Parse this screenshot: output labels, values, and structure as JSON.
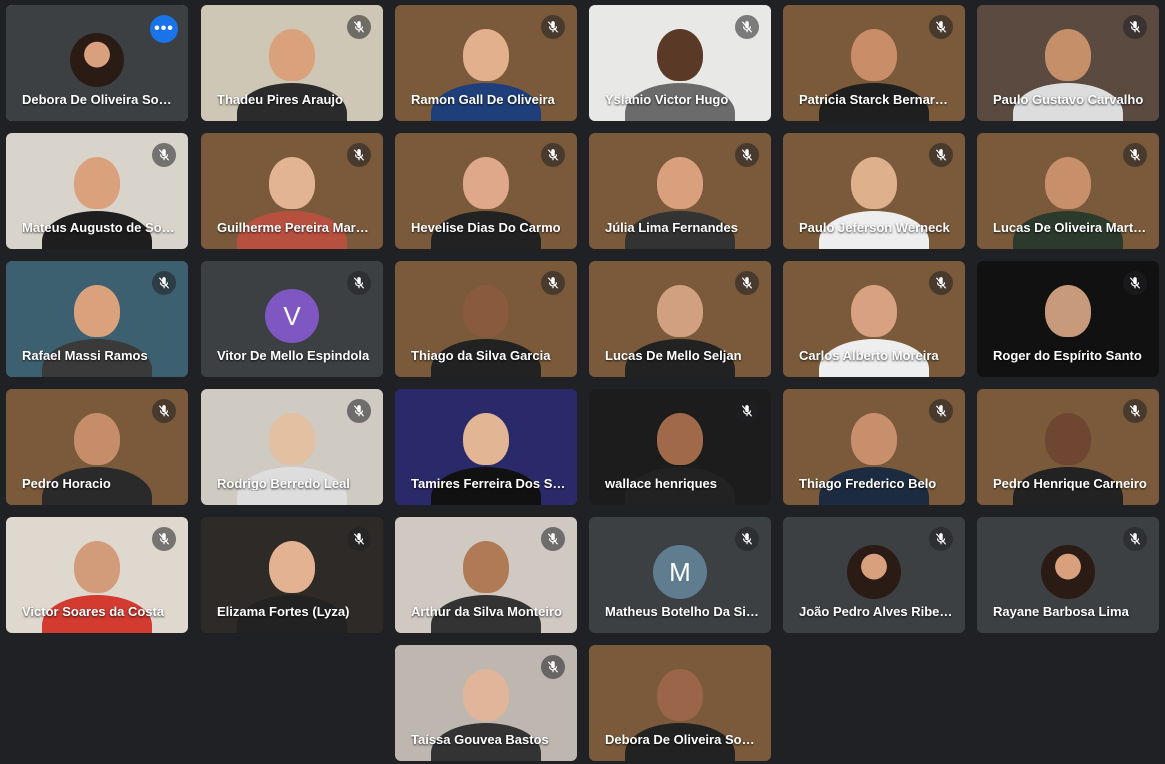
{
  "meeting": {
    "more_options_label": "•••",
    "colors": {
      "background": "#202124",
      "tile": "#3c4043",
      "active_border": "#8ab4f8",
      "more_button": "#1a73e8"
    },
    "participants": [
      {
        "name": "Debora De Oliveira Soares",
        "muted": false,
        "pinned_active": true,
        "avatar": "photo-circle",
        "bg": "#3c4043"
      },
      {
        "name": "Thadeu Pires Araujo",
        "muted": true,
        "bg": "#cfc7b6",
        "skin": "#d9a27c",
        "shirt": "#2b2b2b"
      },
      {
        "name": "Ramon Gall De Oliveira",
        "muted": true,
        "bg": "#7a5a3a",
        "skin": "#e2b08c",
        "shirt": "#1f3f7a"
      },
      {
        "name": "Yslanio Victor Hugo",
        "muted": true,
        "bg": "#e8e8e6",
        "skin": "#5a3a26",
        "shirt": "#6b6b6b"
      },
      {
        "name": "Patricia Starck Bernardes",
        "muted": true,
        "bg": "#7a5a3a",
        "skin": "#c98e68",
        "shirt": "#1f1f1f"
      },
      {
        "name": "Paulo Gustavo Carvalho",
        "muted": true,
        "bg": "#5a4a40",
        "skin": "#c58f6a",
        "shirt": "#ddd"
      },
      {
        "name": "Mateus Augusto de Souza",
        "muted": true,
        "bg": "#d8d4cc",
        "skin": "#d9a27c",
        "shirt": "#1e1e1e"
      },
      {
        "name": "Guilherme Pereira Martins",
        "muted": true,
        "bg": "#7a5a3a",
        "skin": "#e3b493",
        "shirt": "#b85040"
      },
      {
        "name": "Hevelise Dias Do Carmo",
        "muted": true,
        "bg": "#7a5a3a",
        "skin": "#e0a88a",
        "shirt": "#222"
      },
      {
        "name": "Júlia Lima Fernandes",
        "muted": true,
        "bg": "#7a5a3a",
        "skin": "#d9a07e",
        "shirt": "#333"
      },
      {
        "name": "Paulo Jeferson Werneck",
        "muted": true,
        "bg": "#7a5a3a",
        "skin": "#dfb08c",
        "shirt": "#eee"
      },
      {
        "name": "Lucas De Oliveira Martins",
        "muted": true,
        "bg": "#7a5a3a",
        "skin": "#c8906a",
        "shirt": "#2b3a2b"
      },
      {
        "name": "Rafael Massi Ramos",
        "muted": true,
        "bg": "#3d6070",
        "skin": "#d9a27c",
        "shirt": "#3a3a3a"
      },
      {
        "name": "Vitor De Mello Espindola",
        "muted": true,
        "avatar": "letter",
        "letter": "V",
        "avatar_color": "#7e57c2",
        "bg": "#3c4043"
      },
      {
        "name": "Thiago da Silva Garcia",
        "muted": true,
        "bg": "#7a5a3a",
        "skin": "#8a5a3e",
        "shirt": "#222"
      },
      {
        "name": "Lucas De Mello Seljan",
        "muted": true,
        "bg": "#7a5a3a",
        "skin": "#d0a080",
        "shirt": "#222"
      },
      {
        "name": "Carlos Alberto Moreira",
        "muted": true,
        "bg": "#7a5a3a",
        "skin": "#d8a282",
        "shirt": "#eee"
      },
      {
        "name": "Roger do Espírito Santo",
        "muted": true,
        "bg": "#111111",
        "skin": "#c79a7c",
        "shirt": "#111"
      },
      {
        "name": "Pedro Horacio",
        "muted": true,
        "bg": "#7a5a3a",
        "skin": "#c68d6a",
        "shirt": "#2a2a2a"
      },
      {
        "name": "Rodrigo Berredo Leal",
        "muted": true,
        "bg": "#cfcac2",
        "skin": "#e3c0a2",
        "shirt": "#ddd"
      },
      {
        "name": "Tamires Ferreira Dos Santos",
        "muted": false,
        "bg": "#2a2a6a",
        "skin": "#e2b594",
        "shirt": "#111"
      },
      {
        "name": "wallace henriques",
        "muted": true,
        "bg": "#1c1c1c",
        "skin": "#a06a4a",
        "shirt": "#222"
      },
      {
        "name": "Thiago Frederico Belo",
        "muted": true,
        "bg": "#7a5a3a",
        "skin": "#c88f6c",
        "shirt": "#1d2b40"
      },
      {
        "name": "Pedro Henrique Carneiro",
        "muted": true,
        "bg": "#7a5a3a",
        "skin": "#6e4632",
        "shirt": "#222"
      },
      {
        "name": "Victor Soares da Costa",
        "muted": true,
        "bg": "#dfd8cf",
        "skin": "#d29c7a",
        "shirt": "#d33a30"
      },
      {
        "name": "Elizama Fortes (Lyza)",
        "muted": true,
        "bg": "#2e2a28",
        "skin": "#e3b292",
        "shirt": "#222"
      },
      {
        "name": "Arthur da Silva Monteiro",
        "muted": true,
        "bg": "#cfc9c2",
        "skin": "#b07a56",
        "shirt": "#333"
      },
      {
        "name": "Matheus Botelho Da Silva",
        "muted": true,
        "avatar": "letter",
        "letter": "M",
        "avatar_color": "#5f7d8e",
        "bg": "#3c4043"
      },
      {
        "name": "João Pedro Alves Ribeiro",
        "muted": true,
        "avatar": "photo-circle",
        "bg": "#3c4043"
      },
      {
        "name": "Rayane Barbosa Lima",
        "muted": true,
        "avatar": "photo-circle",
        "bg": "#3c4043"
      },
      {
        "name": "Taíssa Gouvea Bastos",
        "muted": true,
        "bg": "#bdb7b0",
        "skin": "#e0b59a",
        "shirt": "#333"
      },
      {
        "name": "Debora De Oliveira Soares",
        "muted": false,
        "bg": "#7a5a3a",
        "skin": "#9a6548",
        "shirt": "#222"
      }
    ]
  }
}
